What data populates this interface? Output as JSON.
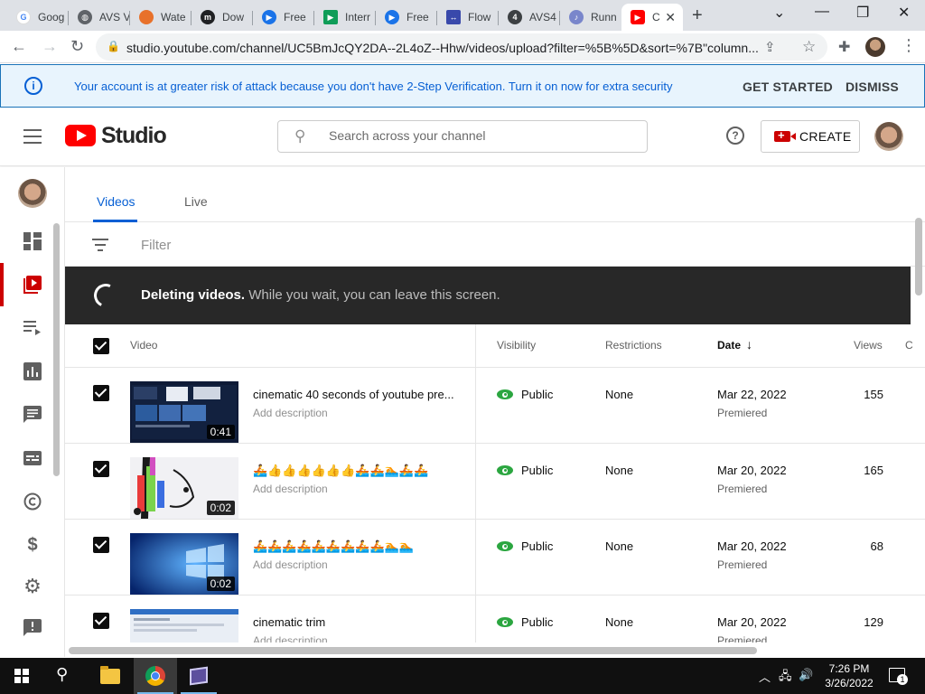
{
  "browser": {
    "tabs": [
      {
        "title": "Goog",
        "favicon_color": "#4285f4",
        "favicon_glyph": "G"
      },
      {
        "title": "AVS V",
        "favicon_color": "#5f6368",
        "favicon_glyph": "◍"
      },
      {
        "title": "Wate",
        "favicon_color": "#e8712a",
        "favicon_glyph": ""
      },
      {
        "title": "Dow",
        "favicon_color": "#202124",
        "favicon_glyph": "m"
      },
      {
        "title": "Free",
        "favicon_color": "#1a73e8",
        "favicon_glyph": "▶"
      },
      {
        "title": "Interr",
        "favicon_color": "#0f9d58",
        "favicon_glyph": "▶"
      },
      {
        "title": "Free",
        "favicon_color": "#1a73e8",
        "favicon_glyph": "▶"
      },
      {
        "title": "Flow",
        "favicon_color": "#3949ab",
        "favicon_glyph": "↔"
      },
      {
        "title": "AVS4",
        "favicon_color": "#3c4043",
        "favicon_glyph": "4"
      },
      {
        "title": "Runn",
        "favicon_color": "#7986cb",
        "favicon_glyph": "♪"
      },
      {
        "title": "C",
        "favicon_color": "#ff0000",
        "favicon_glyph": "▶"
      }
    ],
    "url": "studio.youtube.com/channel/UC5BmJcQY2DA--2L4oZ--Hhw/videos/upload?filter=%5B%5D&sort=%7B\"column..."
  },
  "banner": {
    "message": "Your account is at greater risk of attack because you don't have 2-Step Verification. Turn it on now for extra security",
    "get_started": "GET STARTED",
    "dismiss": "DISMISS"
  },
  "header": {
    "logo_text": "Studio",
    "search_placeholder": "Search across your channel",
    "help_glyph": "?",
    "create_label": "CREATE"
  },
  "content": {
    "tabs": [
      "Videos",
      "Live"
    ],
    "filter_placeholder": "Filter",
    "deleting": {
      "bold": "Deleting videos.",
      "rest": " While you wait, you can leave this screen."
    },
    "columns": {
      "video": "Video",
      "visibility": "Visibility",
      "restrictions": "Restrictions",
      "date": "Date",
      "date_sort_glyph": "↓",
      "views": "Views",
      "comments": "C"
    },
    "videos": [
      {
        "title": "cinematic 40 seconds of youtube pre...",
        "description": "Add description",
        "duration": "0:41",
        "visibility": "Public",
        "restrictions": "None",
        "date": "Mar 22, 2022",
        "date_type": "Premiered",
        "views": "155",
        "checked": true
      },
      {
        "title": "🚣👍👍👍👍👍👍🚣🚣🏊🚣🚣",
        "description": "Add description",
        "duration": "0:02",
        "visibility": "Public",
        "restrictions": "None",
        "date": "Mar 20, 2022",
        "date_type": "Premiered",
        "views": "165",
        "checked": true
      },
      {
        "title": "🚣🚣🚣🚣🚣🚣🚣🚣🚣🏊🏊",
        "description": "Add description",
        "duration": "0:02",
        "visibility": "Public",
        "restrictions": "None",
        "date": "Mar 20, 2022",
        "date_type": "Premiered",
        "views": "68",
        "checked": true
      },
      {
        "title": "cinematic trim",
        "description": "Add description",
        "duration": "",
        "visibility": "Public",
        "restrictions": "None",
        "date": "Mar 20, 2022",
        "date_type": "Premiered",
        "views": "129",
        "checked": true
      }
    ]
  },
  "taskbar": {
    "time": "7:26 PM",
    "date": "3/26/2022",
    "notification_count": "1"
  },
  "colors": {
    "accent_blue": "#065fd4",
    "brand_red": "#ff0000",
    "public_green": "#2ba640"
  }
}
